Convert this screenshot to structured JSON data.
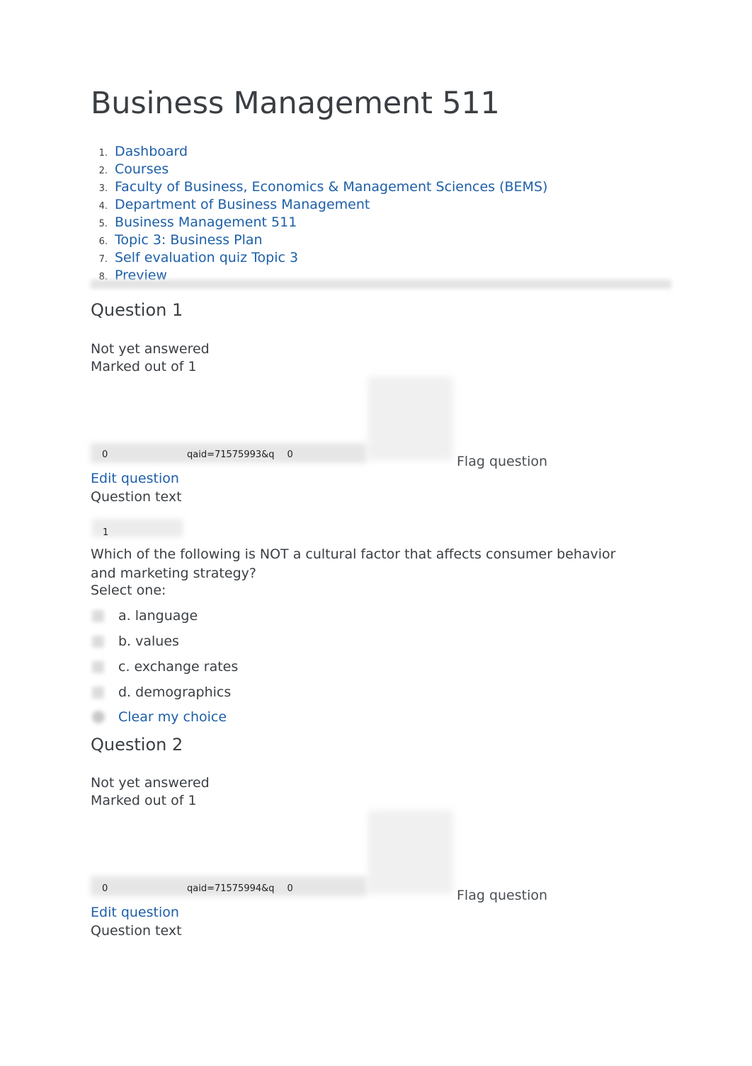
{
  "page": {
    "title": "Business Management 511"
  },
  "breadcrumb": {
    "items": [
      {
        "num": "1.",
        "label": "Dashboard"
      },
      {
        "num": "2.",
        "label": "Courses"
      },
      {
        "num": "3.",
        "label": "Faculty of Business, Economics & Management Sciences (BEMS)"
      },
      {
        "num": "4.",
        "label": "Department of Business Management"
      },
      {
        "num": "5.",
        "label": "Business Management 511"
      },
      {
        "num": "6.",
        "label": "Topic 3: Business Plan"
      },
      {
        "num": "7.",
        "label": "Self evaluation quiz Topic 3"
      },
      {
        "num": "8.",
        "label": "Preview"
      }
    ]
  },
  "questions": [
    {
      "heading": "Question 1",
      "status": "Not yet answered",
      "marks": "Marked out of 1",
      "qaid_zero_left": "0",
      "qaid": "qaid=71575993&q",
      "qaid_zero_right": "0",
      "flag_label": "Flag question",
      "edit_label": "Edit question",
      "question_text_label": "Question text",
      "one_marker": "1",
      "body": "Which of the following is NOT a cultural factor that affects consumer behavior and marketing strategy?",
      "select_one": "Select one:",
      "options": [
        {
          "label": "a. language"
        },
        {
          "label": "b. values"
        },
        {
          "label": "c. exchange rates"
        },
        {
          "label": "d. demographics"
        }
      ],
      "clear_choice": "Clear my choice"
    },
    {
      "heading": "Question 2",
      "status": "Not yet answered",
      "marks": "Marked out of 1",
      "qaid_zero_left": "0",
      "qaid": "qaid=71575994&q",
      "qaid_zero_right": "0",
      "flag_label": "Flag question",
      "edit_label": "Edit question",
      "question_text_label": "Question text"
    }
  ],
  "colors": {
    "link": "#1d5fa8",
    "text": "#3a3f44",
    "background": "#ffffff"
  }
}
